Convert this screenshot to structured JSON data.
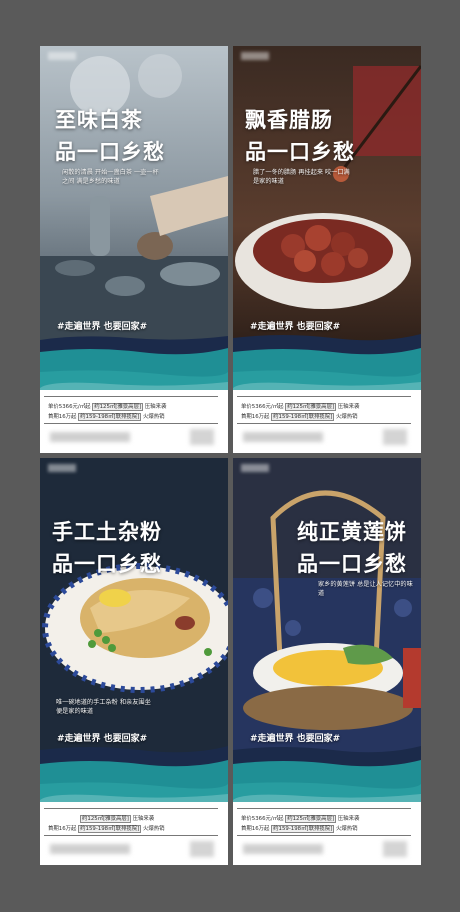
{
  "posters": [
    {
      "title_line1": "至味白茶",
      "title_line2": "品一口乡愁",
      "subtitle": "闲散的清晨 开始一盏白茶 一壶一杯之间 满是乡愁的味道",
      "tag": "#走遍世界 也要回家#",
      "info_line1_prefix": "单价5366元/㎡起",
      "info_line1_mid": "约125㎡[雅景高层]",
      "info_line1_suffix": "压轴来袭",
      "info_line2_prefix": "首期16万起",
      "info_line2_mid": "约159-198㎡[联排揽院]",
      "info_line2_suffix": "火爆热销"
    },
    {
      "title_line1": "飘香腊肠",
      "title_line2": "品一口乡愁",
      "subtitle": "腊了一冬的腊肠 再挂起来 咬一口满是家的味道",
      "tag": "#走遍世界 也要回家#",
      "info_line1_prefix": "单价5366元/㎡起",
      "info_line1_mid": "约125㎡[雅景高层]",
      "info_line1_suffix": "压轴来袭",
      "info_line2_prefix": "首期16万起",
      "info_line2_mid": "约159-198㎡[联排揽院]",
      "info_line2_suffix": "火爆热销"
    },
    {
      "title_line1": "手工土杂粉",
      "title_line2": "品一口乡愁",
      "subtitle": "唯一碗地道的手工杂粉 和亲友围坐 便是家的味道",
      "tag": "#走遍世界 也要回家#",
      "info_line1_prefix": "",
      "info_line1_mid": "约125㎡[雅景高层]",
      "info_line1_suffix": "压轴来袭",
      "info_line2_prefix": "首期16万起",
      "info_line2_mid": "约159-198㎡[联排揽院]",
      "info_line2_suffix": "火爆热销"
    },
    {
      "title_line1": "纯正黄莲饼",
      "title_line2": "品一口乡愁",
      "subtitle": "家乡的黄莲饼 总是让人记忆中的味道",
      "tag": "#走遍世界 也要回家#",
      "info_line1_prefix": "单价5366元/㎡起",
      "info_line1_mid": "约125㎡[雅景高层]",
      "info_line1_suffix": "压轴来袭",
      "info_line2_prefix": "首期16万起",
      "info_line2_mid": "约159-198㎡[联排揽院]",
      "info_line2_suffix": "火爆热销"
    }
  ],
  "colors": {
    "background": "#5a5a5a",
    "teal_brush": "#1f8f95",
    "navy_brush": "#1b2a4a"
  }
}
